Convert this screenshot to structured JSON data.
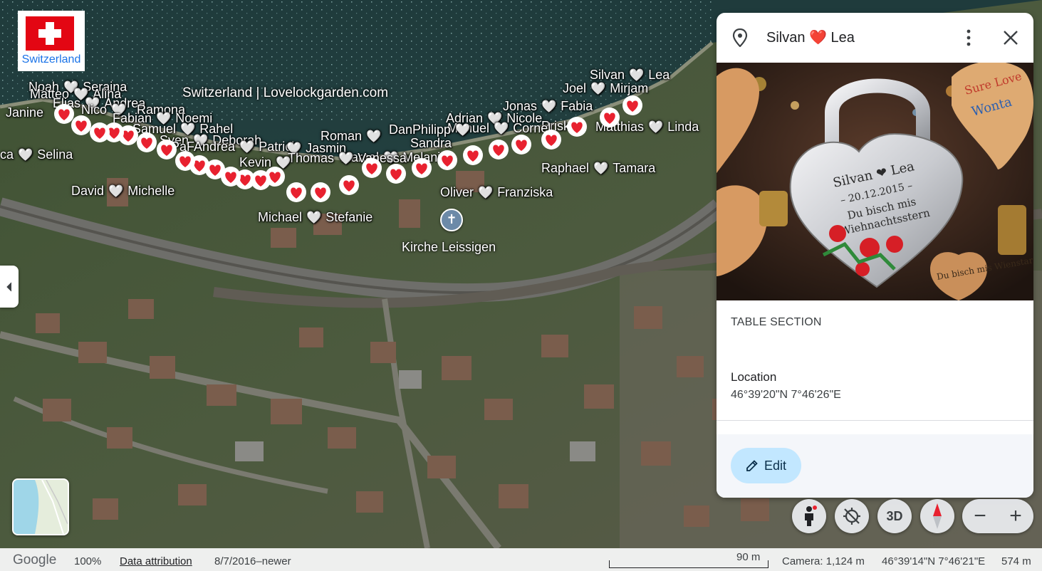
{
  "brand": {
    "flag_text": "Switzerland"
  },
  "map": {
    "site_label": "Switzerland | Lovelockgarden.com",
    "poi": {
      "church": "Kirche Leissigen"
    },
    "couples": [
      {
        "a": "Silvan",
        "b": "Lea"
      },
      {
        "a": "Joel",
        "b": "Mirjam"
      },
      {
        "a": "Jonas",
        "b": "Fabia"
      },
      {
        "a": "Matthias",
        "b": "Linda"
      },
      {
        "a": "Adrian",
        "b": "Nicole"
      },
      {
        "a": "Priska",
        "b": ""
      },
      {
        "a": "Manuel",
        "b": "Cornel"
      },
      {
        "a": "DanPhilipp",
        "b": "Sandra"
      },
      {
        "a": "Roman",
        "b": ""
      },
      {
        "a": "Marcel",
        "b": "Melanie"
      },
      {
        "a": "Raphael",
        "b": "Tamara"
      },
      {
        "a": "Oliver",
        "b": "Franziska"
      },
      {
        "a": "Michael",
        "b": "Stefanie"
      },
      {
        "a": "David",
        "b": "Michelle"
      },
      {
        "a": "ca",
        "b": "Selina"
      },
      {
        "a": "Janine",
        "b": ""
      },
      {
        "a": "Noah",
        "b": "Seraina"
      },
      {
        "a": "Matteo",
        "b": "Alina"
      },
      {
        "a": "Elias",
        "b": "Andrea"
      },
      {
        "a": "Nico",
        "b": ""
      },
      {
        "a": "Ramona",
        "b": ""
      },
      {
        "a": "Fabian",
        "b": "Noemi"
      },
      {
        "a": "Samuel",
        "b": "Rahel"
      },
      {
        "a": "Sven",
        "b": "Deborah"
      },
      {
        "a": "PaFAndrea",
        "b": "Patrick"
      },
      {
        "a": "Jasmin",
        "b": ""
      },
      {
        "a": "Thomas",
        "b": "Vanessa"
      },
      {
        "a": "Kevin",
        "b": ""
      }
    ]
  },
  "panel": {
    "title_a": "Silvan",
    "title_heart": "❤️",
    "title_b": "Lea",
    "photo_lock_line1": "Silvan ❤ Lea",
    "photo_lock_line2": "– 20.12.2015 –",
    "photo_lock_line3": "Du bisch mis",
    "photo_lock_line4": "Wiehnachtsstern",
    "photo_left_lock": "Du bisch mis Wienstar",
    "table_section": "TABLE SECTION",
    "location_label": "Location",
    "location_value": "46°39'20\"N 7°46'26\"E",
    "edit_label": "Edit"
  },
  "controls": {
    "three_d_label": "3D",
    "zoom_out": "−",
    "zoom_in": "+"
  },
  "statusbar": {
    "logo": "Google",
    "zoom": "100%",
    "data_attribution": "Data attribution",
    "imagery_date": "8/7/2016–newer",
    "scale": "90 m",
    "camera": "Camera: 1,124 m",
    "coords": "46°39'14\"N 7°46'21\"E",
    "elevation": "574 m"
  },
  "colors": {
    "pin_red": "#e8212f",
    "edit_bg": "#c2e7ff",
    "flag_red": "#e30613",
    "link_blue": "#1a73e8"
  }
}
